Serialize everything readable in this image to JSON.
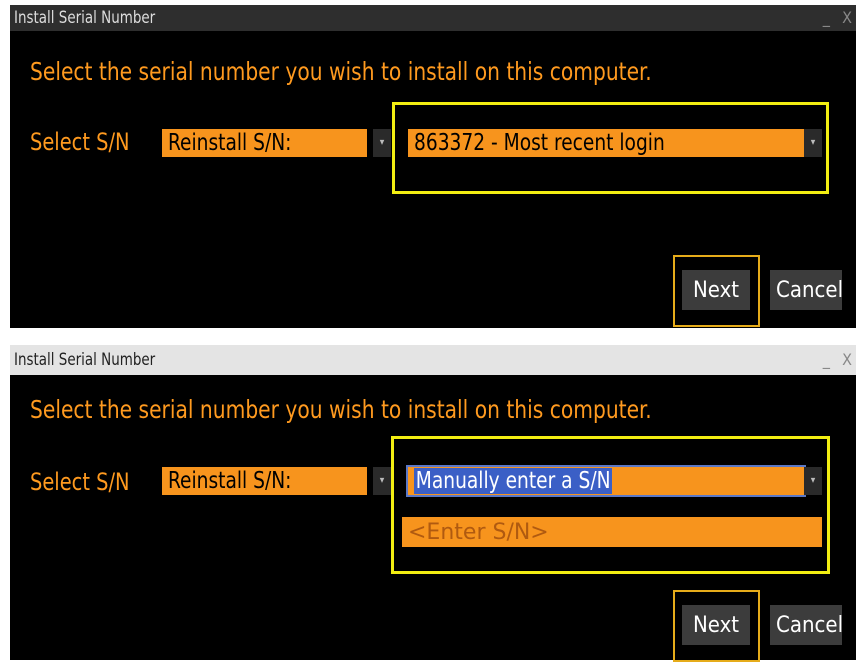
{
  "dialog1": {
    "title": "Install Serial Number",
    "prompt": "Select the serial number you wish to install on this computer.",
    "select_label": "Select S/N",
    "reinstall_dropdown": "Reinstall S/N:",
    "serial_dropdown": "863372 - Most recent login",
    "next_label": "Next",
    "cancel_label": "Cancel",
    "minimize": "_",
    "close": "X"
  },
  "dialog2": {
    "title": "Install Serial Number",
    "prompt": "Select the serial number you wish to install on this computer.",
    "select_label": "Select S/N",
    "reinstall_dropdown": "Reinstall S/N:",
    "serial_dropdown": "Manually enter a S/N",
    "sn_input_placeholder": "<Enter S/N>",
    "sn_input_value": "",
    "next_label": "Next",
    "cancel_label": "Cancel",
    "minimize": "_",
    "close": "X"
  },
  "colors": {
    "accent": "#f7941d",
    "prompt_text": "#ff9a1f",
    "highlight_box": "#f2ee12",
    "background": "#000000"
  },
  "icons": {
    "dropdown_arrow": "chevron-down-icon"
  }
}
